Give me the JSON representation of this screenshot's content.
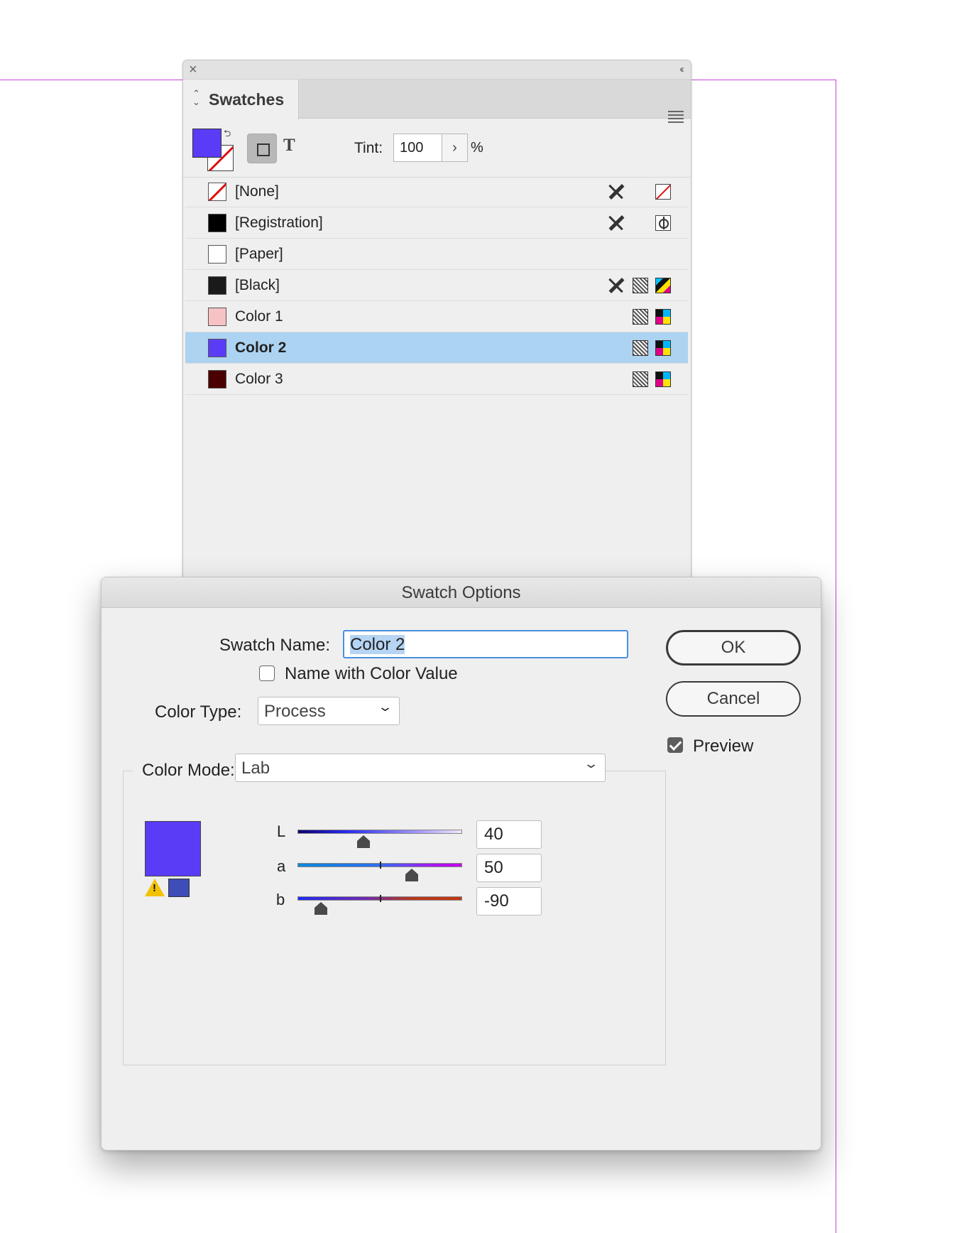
{
  "swatches_panel": {
    "title": "Swatches",
    "tint_label": "Tint:",
    "tint_value": "100",
    "tint_unit": "%",
    "fill_color": "#5a3cf7",
    "items": [
      {
        "label": "[None]",
        "chip_color": "none",
        "icons": [
          "pencil-off-icon",
          "none-icon"
        ]
      },
      {
        "label": "[Registration]",
        "chip_color": "#000000",
        "icons": [
          "pencil-off-icon",
          "registration-icon"
        ]
      },
      {
        "label": "[Paper]",
        "chip_color": "#ffffff",
        "icons": []
      },
      {
        "label": "[Black]",
        "chip_color": "#1a1a1a",
        "icons": [
          "pencil-off-icon",
          "process-icon",
          "cmyk-icon"
        ]
      },
      {
        "label": "Color 1",
        "chip_color": "#f7c2c4",
        "icons": [
          "process-icon",
          "cmyk-icon"
        ]
      },
      {
        "label": "Color 2",
        "chip_color": "#5a3cf7",
        "icons": [
          "process-icon",
          "cmyk-icon"
        ],
        "selected": true
      },
      {
        "label": "Color 3",
        "chip_color": "#4a0000",
        "icons": [
          "process-icon",
          "cmyk-icon"
        ]
      }
    ]
  },
  "swatch_options": {
    "title": "Swatch Options",
    "swatch_name_label": "Swatch Name:",
    "swatch_name_value": "Color 2",
    "name_with_color_value_label": "Name with Color Value",
    "name_with_color_value_checked": false,
    "color_type_label": "Color Type:",
    "color_type_value": "Process",
    "color_mode_label": "Color Mode:",
    "color_mode_value": "Lab",
    "ok_label": "OK",
    "cancel_label": "Cancel",
    "preview_label": "Preview",
    "preview_checked": true,
    "preview_color": "#5a3cf7",
    "out_of_gamut_color": "#3f4db8",
    "sliders": [
      {
        "label": "L",
        "value": "40",
        "level": 0.4
      },
      {
        "label": "a",
        "value": "50",
        "level": 0.695
      },
      {
        "label": "b",
        "value": "-90",
        "level": 0.14
      }
    ]
  }
}
